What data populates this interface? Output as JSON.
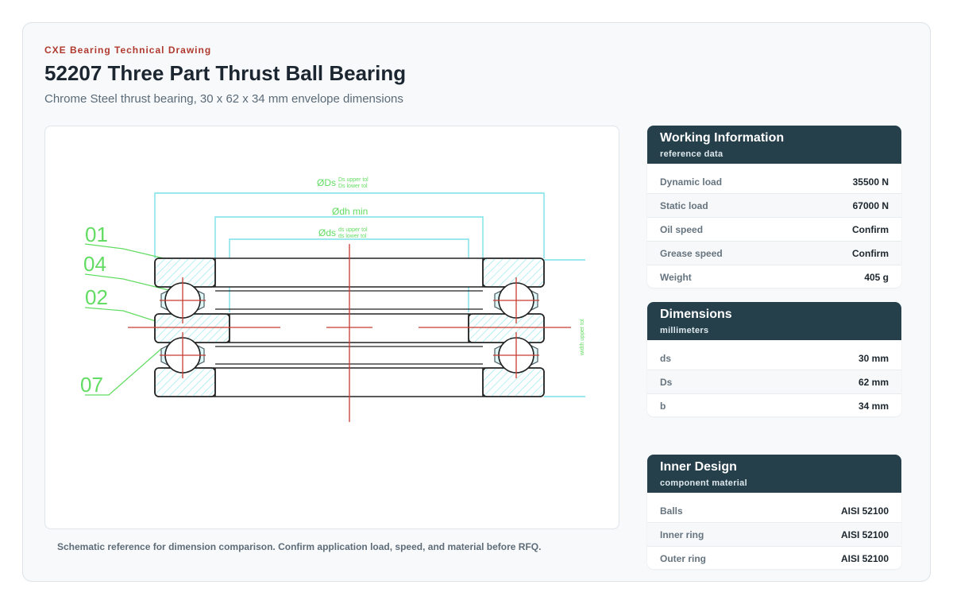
{
  "header": {
    "eyebrow": "CXE Bearing Technical Drawing",
    "title": "52207 Three Part Thrust Ball Bearing",
    "subtitle": "Chrome Steel thrust bearing, 30 x 62 x 34 mm envelope dimensions"
  },
  "drawing": {
    "dim_outer": {
      "symbol": "ØDs",
      "upper": "Ds upper tol",
      "lower": "Ds lower tol"
    },
    "dim_housing": "Ødh min",
    "dim_inner": {
      "symbol": "Øds",
      "upper": "ds upper tol",
      "lower": "ds lower tol"
    },
    "dim_width": "width upper tol",
    "callouts": [
      "01",
      "04",
      "02",
      "07"
    ],
    "colors": {
      "dimension": "#7ae0e8",
      "callout": "#62dc62",
      "centerline": "#c83c32",
      "outline": "#222222",
      "hatch": "#8fe6ec"
    },
    "caption": "Schematic reference for dimension comparison. Confirm application load, speed, and material before RFQ."
  },
  "working": {
    "title": "Working Information",
    "subtitle": "reference data",
    "rows": [
      {
        "label": "Dynamic load",
        "value": "35500 N"
      },
      {
        "label": "Static load",
        "value": "67000 N"
      },
      {
        "label": "Oil speed",
        "value": "Confirm"
      },
      {
        "label": "Grease speed",
        "value": "Confirm"
      },
      {
        "label": "Weight",
        "value": "405 g"
      }
    ]
  },
  "dimensions": {
    "title": "Dimensions",
    "subtitle": "millimeters",
    "rows": [
      {
        "label": "ds",
        "value": "30 mm"
      },
      {
        "label": "Ds",
        "value": "62 mm"
      },
      {
        "label": "b",
        "value": "34 mm"
      }
    ]
  },
  "inner_design": {
    "title": "Inner Design",
    "subtitle": "component material",
    "rows": [
      {
        "label": "Balls",
        "value": "AISI 52100"
      },
      {
        "label": "Inner ring",
        "value": "AISI 52100"
      },
      {
        "label": "Outer ring",
        "value": "AISI 52100"
      }
    ]
  }
}
